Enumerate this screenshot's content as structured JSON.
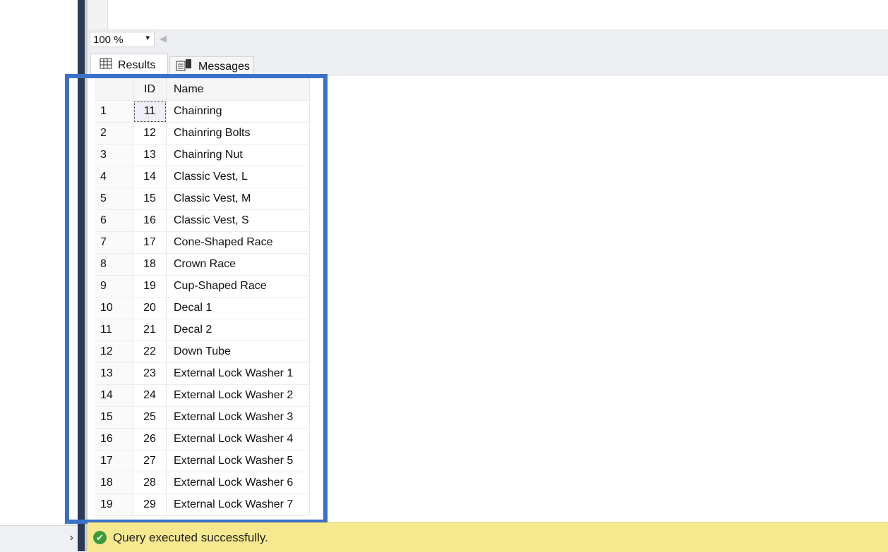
{
  "zoom": {
    "value": "100 %"
  },
  "tabs": {
    "results": "Results",
    "messages": "Messages"
  },
  "grid": {
    "columns": [
      "ID",
      "Name"
    ],
    "rows": [
      {
        "n": "1",
        "id": "11",
        "name": "Chainring"
      },
      {
        "n": "2",
        "id": "12",
        "name": "Chainring Bolts"
      },
      {
        "n": "3",
        "id": "13",
        "name": "Chainring Nut"
      },
      {
        "n": "4",
        "id": "14",
        "name": "Classic Vest, L"
      },
      {
        "n": "5",
        "id": "15",
        "name": "Classic Vest, M"
      },
      {
        "n": "6",
        "id": "16",
        "name": "Classic Vest, S"
      },
      {
        "n": "7",
        "id": "17",
        "name": "Cone-Shaped Race"
      },
      {
        "n": "8",
        "id": "18",
        "name": "Crown Race"
      },
      {
        "n": "9",
        "id": "19",
        "name": "Cup-Shaped Race"
      },
      {
        "n": "10",
        "id": "20",
        "name": "Decal 1"
      },
      {
        "n": "11",
        "id": "21",
        "name": "Decal 2"
      },
      {
        "n": "12",
        "id": "22",
        "name": "Down Tube"
      },
      {
        "n": "13",
        "id": "23",
        "name": "External Lock Washer 1"
      },
      {
        "n": "14",
        "id": "24",
        "name": "External Lock Washer 2"
      },
      {
        "n": "15",
        "id": "25",
        "name": "External Lock Washer 3"
      },
      {
        "n": "16",
        "id": "26",
        "name": "External Lock Washer 4"
      },
      {
        "n": "17",
        "id": "27",
        "name": "External Lock Washer 5"
      },
      {
        "n": "18",
        "id": "28",
        "name": "External Lock Washer 6"
      },
      {
        "n": "19",
        "id": "29",
        "name": "External Lock Washer 7"
      }
    ]
  },
  "status": {
    "text": "Query executed successfully.",
    "icon": "check-circle-icon"
  },
  "colors": {
    "highlight": "#3b71c9",
    "status_bg": "#f7e98f"
  }
}
